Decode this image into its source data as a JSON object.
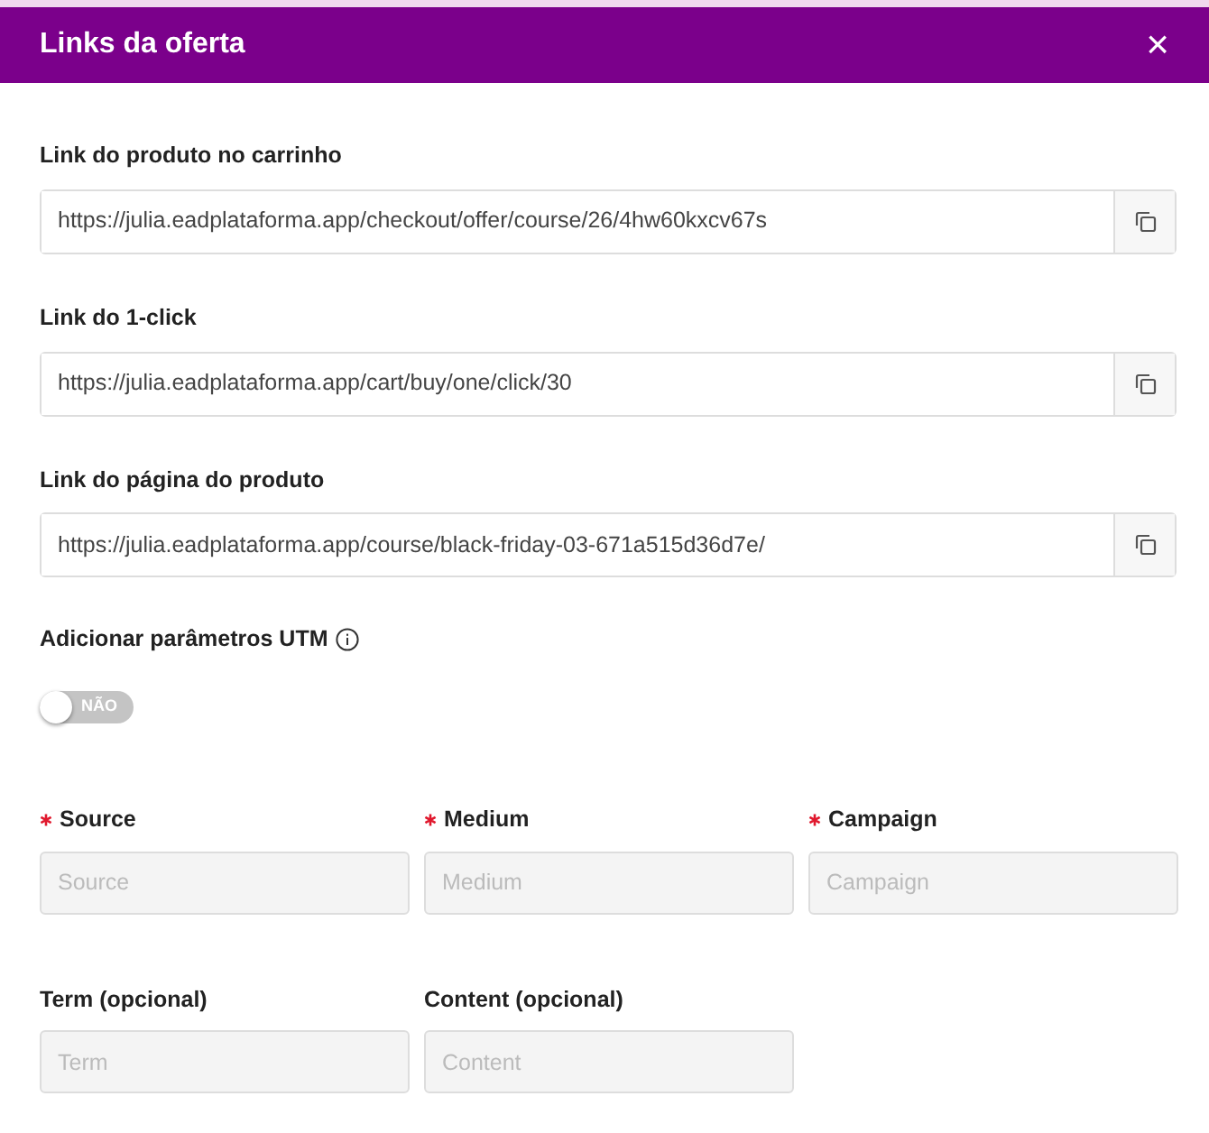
{
  "modal": {
    "title": "Links da oferta",
    "close": "×"
  },
  "links": [
    {
      "label": "Link do produto no carrinho",
      "value": "https://julia.eadplataforma.app/checkout/offer/course/26/4hw60kxcv67s"
    },
    {
      "label": "Link do 1-click",
      "value": "https://julia.eadplataforma.app/cart/buy/one/click/30"
    },
    {
      "label": "Link do página do produto",
      "value": "https://julia.eadplataforma.app/course/black-friday-03-671a515d36d7e/"
    }
  ],
  "utm": {
    "label": "Adicionar parâmetros UTM",
    "toggle": {
      "on": false,
      "text": "NÃO"
    },
    "fields": [
      {
        "label": "Source",
        "placeholder": "Source",
        "required": true,
        "disabled": true
      },
      {
        "label": "Medium",
        "placeholder": "Medium",
        "required": true,
        "disabled": true
      },
      {
        "label": "Campaign",
        "placeholder": "Campaign",
        "required": true,
        "disabled": true
      },
      {
        "label": "Term (opcional)",
        "placeholder": "Term",
        "required": false,
        "disabled": true
      },
      {
        "label": "Content (opcional)",
        "placeholder": "Content",
        "required": false,
        "disabled": true
      }
    ]
  }
}
